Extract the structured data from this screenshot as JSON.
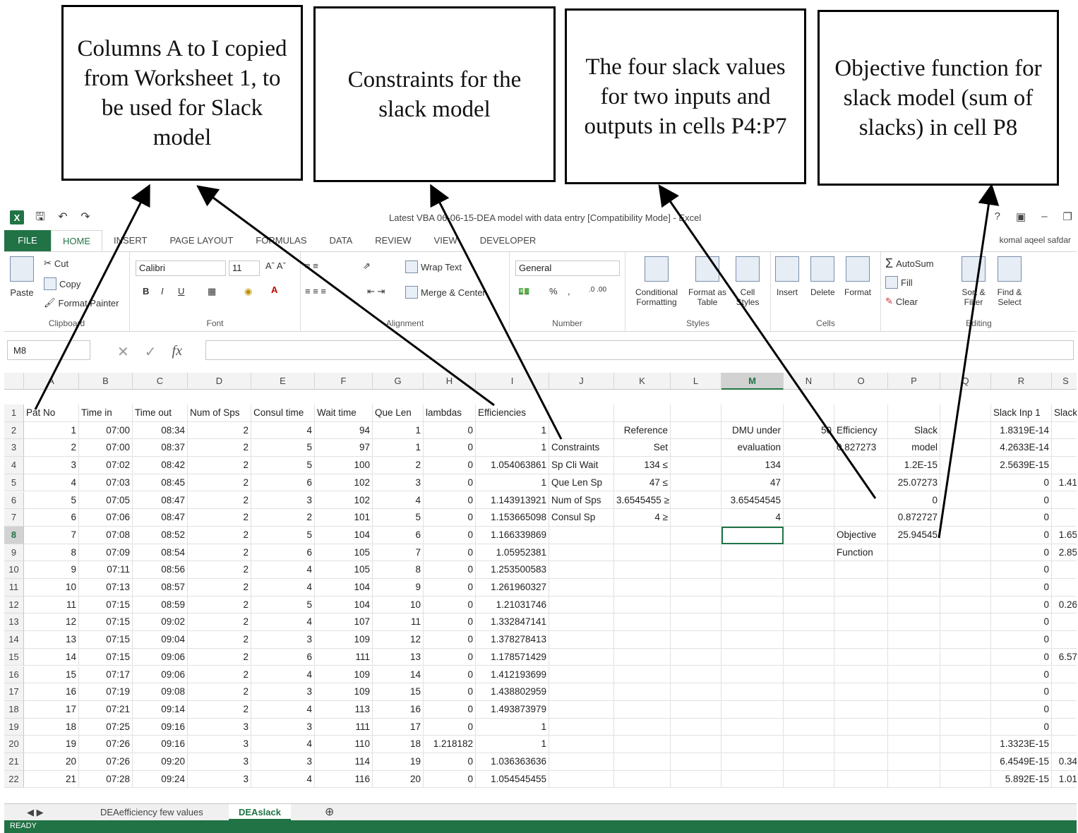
{
  "callouts": [
    "Columns A to I copied from Worksheet 1, to be used for Slack model",
    "Constraints for the slack model",
    "The four slack values for two inputs and outputs in cells P4:P7",
    "Objective function for slack model (sum of slacks) in cell P8"
  ],
  "window": {
    "title": "Latest VBA 06-06-15-DEA model with data entry  [Compatibility Mode] - Excel",
    "controls": [
      "?",
      "▣",
      "–",
      "❐"
    ],
    "user": "komal aqeel safdar"
  },
  "ribbon_tabs": [
    "FILE",
    "HOME",
    "INSERT",
    "PAGE LAYOUT",
    "FORMULAS",
    "DATA",
    "REVIEW",
    "VIEW",
    "DEVELOPER"
  ],
  "ribbon": {
    "clipboard": {
      "label": "Clipboard",
      "paste": "Paste",
      "cut": "Cut",
      "copy": "Copy",
      "format_painter": "Format Painter"
    },
    "font": {
      "label": "Font",
      "name": "Calibri",
      "size": "11",
      "bold": "B",
      "italic": "I",
      "underline": "U"
    },
    "alignment": {
      "label": "Alignment",
      "wrap": "Wrap Text",
      "merge": "Merge & Center"
    },
    "number": {
      "label": "Number",
      "format": "General",
      "percent": "%",
      "comma": ","
    },
    "styles": {
      "label": "Styles",
      "conditional": "Conditional Formatting",
      "format_table": "Format as Table",
      "cell_styles": "Cell Styles"
    },
    "cells": {
      "label": "Cells",
      "insert": "Insert",
      "delete": "Delete",
      "format": "Format"
    },
    "editing": {
      "label": "Editing",
      "autosum": "AutoSum",
      "fill": "Fill",
      "clear": "Clear",
      "sort": "Sort & Filter",
      "find": "Find & Select"
    }
  },
  "namebox": "M8",
  "fx": "fx",
  "columns": [
    "A",
    "B",
    "C",
    "D",
    "E",
    "F",
    "G",
    "H",
    "I",
    "J",
    "K",
    "L",
    "M",
    "N",
    "O",
    "P",
    "Q",
    "R",
    "S"
  ],
  "rows": [
    {
      "n": "1",
      "c": [
        "Pat No",
        "Time in",
        "Time out",
        "Num of Sps",
        "Consul time",
        "Wait time",
        "Que Len",
        "lambdas",
        "Efficiencies",
        "",
        "",
        "",
        "",
        "",
        "",
        "",
        "",
        "Slack Inp 1",
        "Slack"
      ]
    },
    {
      "n": "2",
      "c": [
        "1",
        "07:00",
        "08:34",
        "2",
        "4",
        "94",
        "1",
        "0",
        "1",
        "",
        "Reference",
        "",
        "DMU under",
        "50",
        "Efficiency",
        "Slack",
        "",
        "1.8319E-14",
        ""
      ]
    },
    {
      "n": "3",
      "c": [
        "2",
        "07:00",
        "08:37",
        "2",
        "5",
        "97",
        "1",
        "0",
        "1",
        "Constraints",
        "Set",
        "",
        "evaluation",
        "",
        "0.827273",
        "model",
        "",
        "4.2633E-14",
        ""
      ]
    },
    {
      "n": "4",
      "c": [
        "3",
        "07:02",
        "08:42",
        "2",
        "5",
        "100",
        "2",
        "0",
        "1.054063861",
        "Sp Cli Wait",
        "134 ≤",
        "",
        "134",
        "",
        "",
        "1.2E-15",
        "",
        "2.5639E-15",
        ""
      ]
    },
    {
      "n": "5",
      "c": [
        "4",
        "07:03",
        "08:45",
        "2",
        "6",
        "102",
        "3",
        "0",
        "1",
        "Que Len Sp",
        "47 ≤",
        "",
        "47",
        "",
        "",
        "25.07273",
        "",
        "0",
        "1.41"
      ]
    },
    {
      "n": "6",
      "c": [
        "5",
        "07:05",
        "08:47",
        "2",
        "3",
        "102",
        "4",
        "0",
        "1.143913921",
        "Num of Sps",
        "3.6545455 ≥",
        "",
        "3.65454545",
        "",
        "",
        "0",
        "",
        "0",
        ""
      ]
    },
    {
      "n": "7",
      "c": [
        "6",
        "07:06",
        "08:47",
        "2",
        "2",
        "101",
        "5",
        "0",
        "1.153665098",
        "Consul Sp",
        "4 ≥",
        "",
        "4",
        "",
        "",
        "0.872727",
        "",
        "0",
        ""
      ]
    },
    {
      "n": "8",
      "c": [
        "7",
        "07:08",
        "08:52",
        "2",
        "5",
        "104",
        "6",
        "0",
        "1.166339869",
        "",
        "",
        "",
        "",
        "",
        "Objective",
        "25.94545",
        "",
        "0",
        "1.65"
      ]
    },
    {
      "n": "9",
      "c": [
        "8",
        "07:09",
        "08:54",
        "2",
        "6",
        "105",
        "7",
        "0",
        "1.05952381",
        "",
        "",
        "",
        "",
        "",
        "Function",
        "",
        "",
        "0",
        "2.85"
      ]
    },
    {
      "n": "10",
      "c": [
        "9",
        "07:11",
        "08:56",
        "2",
        "4",
        "105",
        "8",
        "0",
        "1.253500583",
        "",
        "",
        "",
        "",
        "",
        "",
        "",
        "",
        "0",
        ""
      ]
    },
    {
      "n": "11",
      "c": [
        "10",
        "07:13",
        "08:57",
        "2",
        "4",
        "104",
        "9",
        "0",
        "1.261960327",
        "",
        "",
        "",
        "",
        "",
        "",
        "",
        "",
        "0",
        ""
      ]
    },
    {
      "n": "12",
      "c": [
        "11",
        "07:15",
        "08:59",
        "2",
        "5",
        "104",
        "10",
        "0",
        "1.21031746",
        "",
        "",
        "",
        "",
        "",
        "",
        "",
        "",
        "0",
        "0.26"
      ]
    },
    {
      "n": "13",
      "c": [
        "12",
        "07:15",
        "09:02",
        "2",
        "4",
        "107",
        "11",
        "0",
        "1.332847141",
        "",
        "",
        "",
        "",
        "",
        "",
        "",
        "",
        "0",
        ""
      ]
    },
    {
      "n": "14",
      "c": [
        "13",
        "07:15",
        "09:04",
        "2",
        "3",
        "109",
        "12",
        "0",
        "1.378278413",
        "",
        "",
        "",
        "",
        "",
        "",
        "",
        "",
        "0",
        ""
      ]
    },
    {
      "n": "15",
      "c": [
        "14",
        "07:15",
        "09:06",
        "2",
        "6",
        "111",
        "13",
        "0",
        "1.178571429",
        "",
        "",
        "",
        "",
        "",
        "",
        "",
        "",
        "0",
        "6.57"
      ]
    },
    {
      "n": "16",
      "c": [
        "15",
        "07:17",
        "09:06",
        "2",
        "4",
        "109",
        "14",
        "0",
        "1.412193699",
        "",
        "",
        "",
        "",
        "",
        "",
        "",
        "",
        "0",
        ""
      ]
    },
    {
      "n": "17",
      "c": [
        "16",
        "07:19",
        "09:08",
        "2",
        "3",
        "109",
        "15",
        "0",
        "1.438802959",
        "",
        "",
        "",
        "",
        "",
        "",
        "",
        "",
        "0",
        ""
      ]
    },
    {
      "n": "18",
      "c": [
        "17",
        "07:21",
        "09:14",
        "2",
        "4",
        "113",
        "16",
        "0",
        "1.493873979",
        "",
        "",
        "",
        "",
        "",
        "",
        "",
        "",
        "0",
        ""
      ]
    },
    {
      "n": "19",
      "c": [
        "18",
        "07:25",
        "09:16",
        "3",
        "3",
        "111",
        "17",
        "0",
        "1",
        "",
        "",
        "",
        "",
        "",
        "",
        "",
        "",
        "0",
        ""
      ]
    },
    {
      "n": "20",
      "c": [
        "19",
        "07:26",
        "09:16",
        "3",
        "4",
        "110",
        "18",
        "1.218182",
        "1",
        "",
        "",
        "",
        "",
        "",
        "",
        "",
        "",
        "1.3323E-15",
        ""
      ]
    },
    {
      "n": "21",
      "c": [
        "20",
        "07:26",
        "09:20",
        "3",
        "3",
        "114",
        "19",
        "0",
        "1.036363636",
        "",
        "",
        "",
        "",
        "",
        "",
        "",
        "",
        "6.4549E-15",
        "0.34"
      ]
    },
    {
      "n": "22",
      "c": [
        "21",
        "07:28",
        "09:24",
        "3",
        "4",
        "116",
        "20",
        "0",
        "1.054545455",
        "",
        "",
        "",
        "",
        "",
        "",
        "",
        "",
        "5.892E-15",
        "1.01"
      ]
    }
  ],
  "sheets": [
    "DEAefficiency few values",
    "DEAslack"
  ],
  "status": "READY"
}
